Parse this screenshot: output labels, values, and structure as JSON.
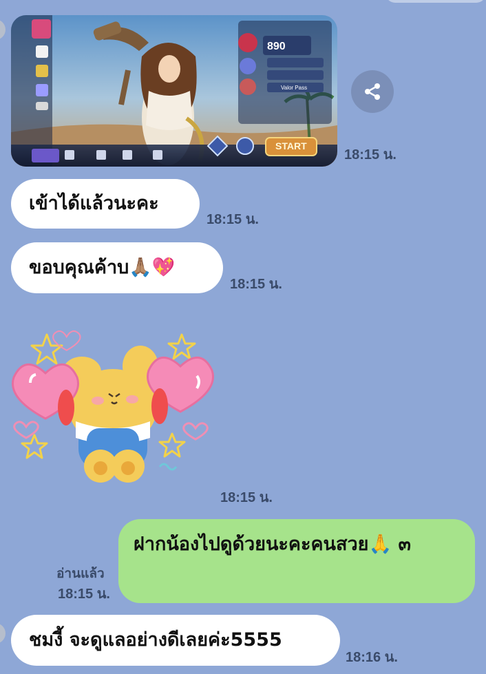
{
  "messages": {
    "image_time": "18:15 น.",
    "msg1_text": "เข้าได้แล้วนะคะ",
    "msg1_time": "18:15 น.",
    "msg2_text": "ขอบคุณค้าบ🙏🏽💖",
    "msg2_time": "18:15 น.",
    "sticker_time": "18:15 น.",
    "sent_text": "ฝากน้องไปดูด้วยนะคะคนสวย🙏 ๓",
    "sent_read": "อ่านแล้ว",
    "sent_time": "18:15 น.",
    "msg4_text": "ชมงี้ จะดูแลอย่างดีเลยค่ะ5555",
    "msg4_time": "18:16 น."
  },
  "game_screenshot": {
    "diamonds": "890",
    "menu_1": "Valor Pass",
    "start_label": "START"
  },
  "colors": {
    "background": "#8ea7d6",
    "received_bubble": "#ffffff",
    "sent_bubble": "#a6e38b",
    "timestamp": "#3a4b6a"
  },
  "icons": [
    "share-icon",
    "sticker-bear",
    "heart-icon",
    "star-icon"
  ]
}
